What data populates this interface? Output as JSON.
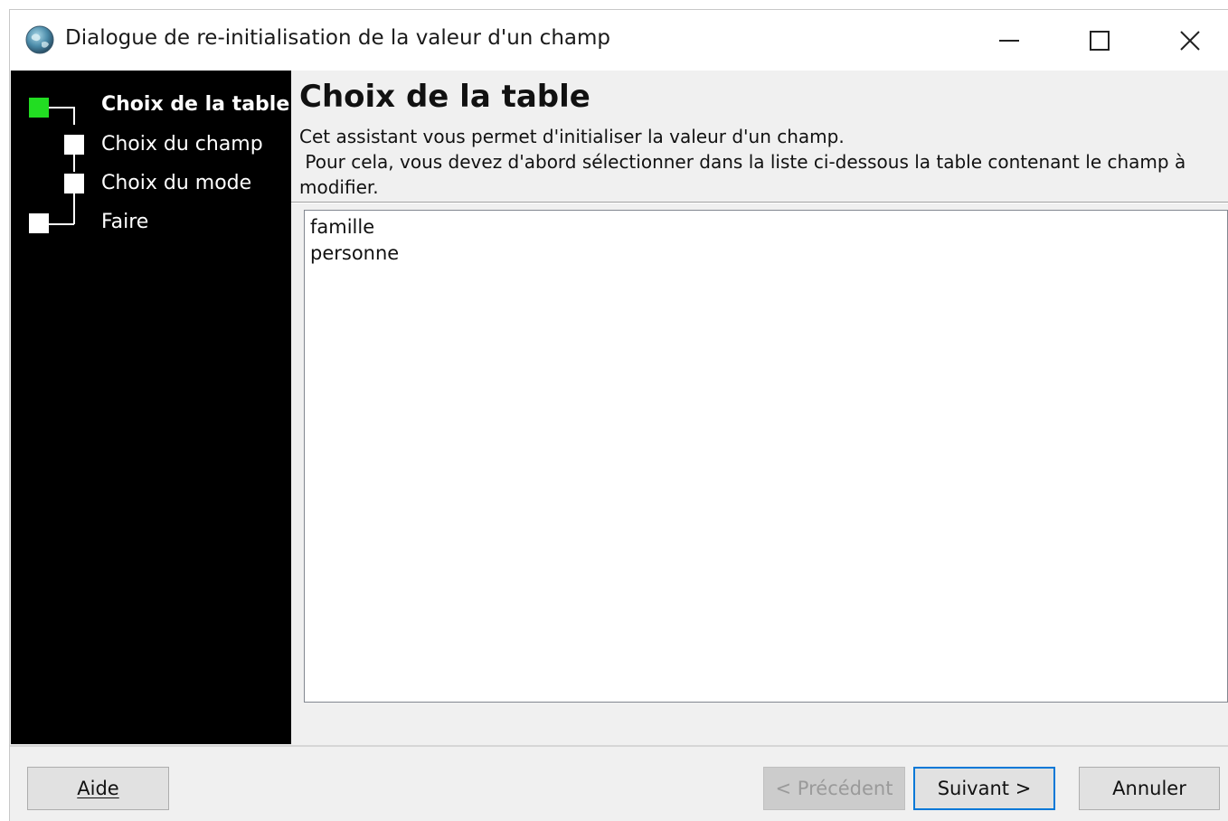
{
  "window": {
    "title": "Dialogue de re-initialisation de la valeur d'un champ",
    "icon": "globe-app-icon",
    "controls": {
      "minimize_icon": "minimize-icon",
      "maximize_icon": "maximize-icon",
      "close_icon": "close-icon"
    }
  },
  "sidebar": {
    "steps": [
      {
        "label": "Choix de la table",
        "current": true
      },
      {
        "label": "Choix du champ",
        "current": false
      },
      {
        "label": "Choix du mode",
        "current": false
      },
      {
        "label": "Faire",
        "current": false
      }
    ],
    "colors": {
      "active_marker": "#22dd22",
      "background": "#000000",
      "text": "#ffffff"
    }
  },
  "main": {
    "title": "Choix de la table",
    "description_lines": [
      "Cet assistant vous permet d'initialiser la valeur d'un champ.",
      " Pour cela, vous devez d'abord sélectionner dans la liste ci-dessous la table contenant le champ à",
      "modifier."
    ],
    "table_list": [
      "famille",
      "personne"
    ]
  },
  "footer": {
    "help_label": "Aide",
    "prev_label": "< Précédent",
    "next_label": "Suivant >",
    "cancel_label": "Annuler",
    "prev_disabled": true,
    "focus_color": "#0078d7"
  }
}
